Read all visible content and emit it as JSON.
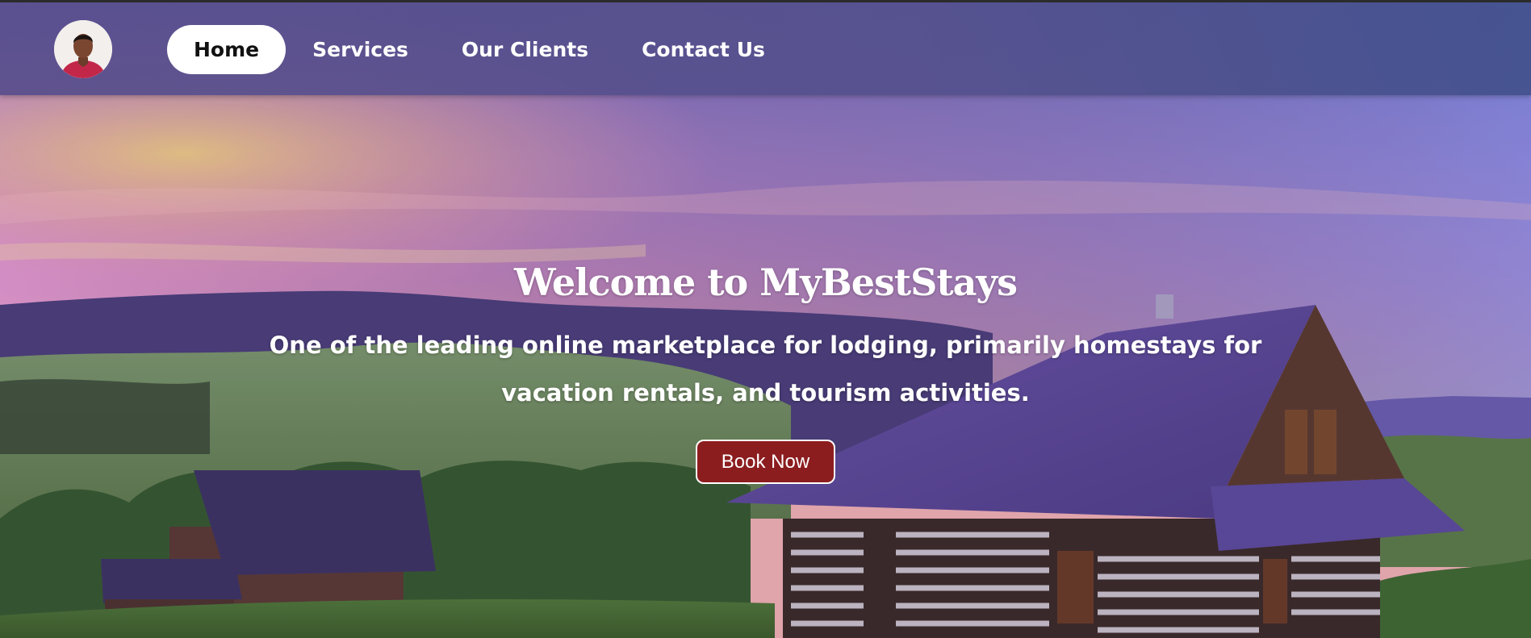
{
  "nav": {
    "items": [
      {
        "label": "Home",
        "active": true
      },
      {
        "label": "Services",
        "active": false
      },
      {
        "label": "Our Clients",
        "active": false
      },
      {
        "label": "Contact Us",
        "active": false
      }
    ]
  },
  "hero": {
    "title": "Welcome to MyBestStays",
    "subtitle": "One of the leading online marketplace for lodging, primarily homestays for vacation rentals, and tourism activities.",
    "cta_label": "Book Now"
  },
  "colors": {
    "cta_background": "#8c1d1f",
    "nav_active_background": "#ffffff",
    "nav_bar": "#584e8c"
  }
}
